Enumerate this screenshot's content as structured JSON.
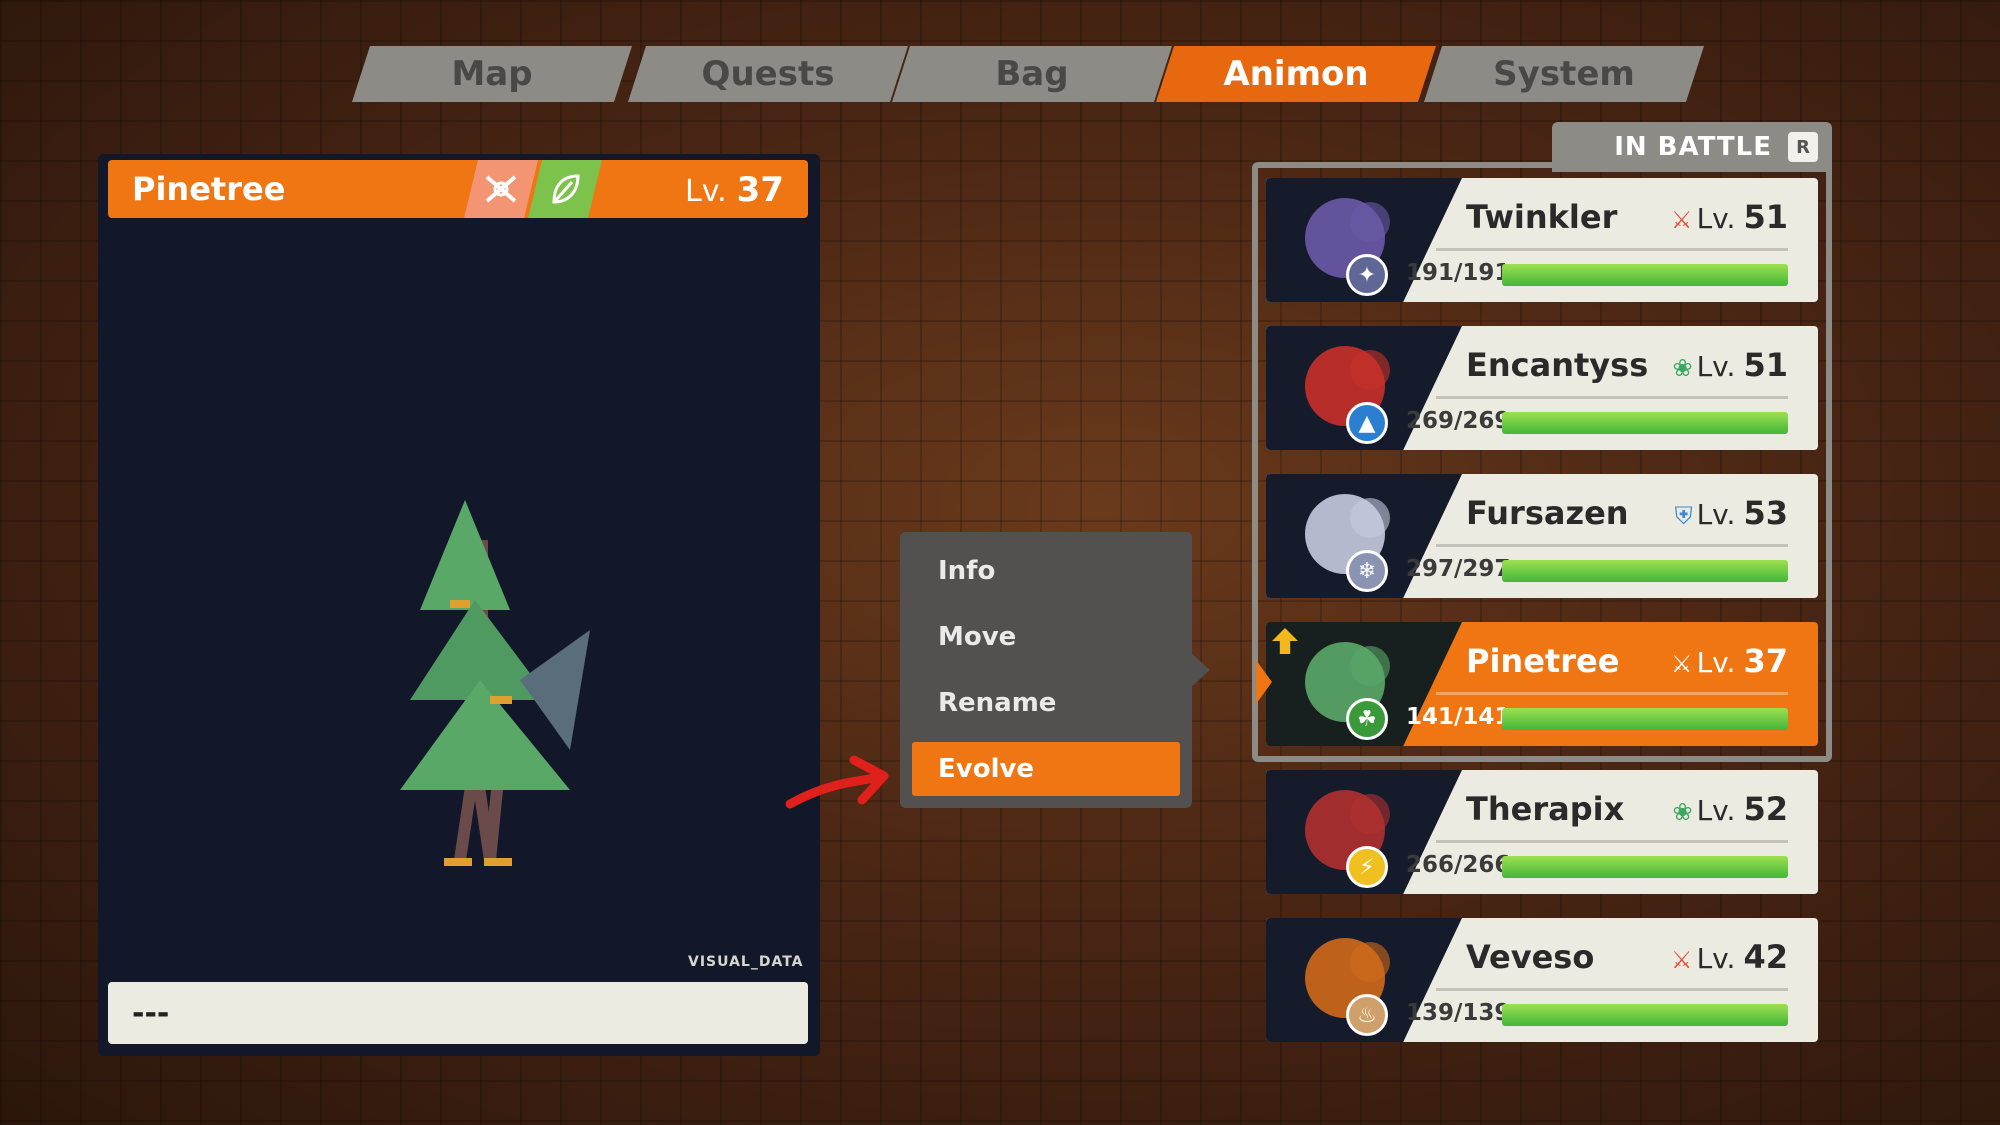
{
  "tabs": [
    {
      "label": "Map",
      "active": false
    },
    {
      "label": "Quests",
      "active": false
    },
    {
      "label": "Bag",
      "active": false
    },
    {
      "label": "Animon",
      "active": true
    },
    {
      "label": "System",
      "active": false
    }
  ],
  "selected_animon": {
    "name": "Pinetree",
    "level_prefix": "Lv.",
    "level": "37",
    "types": [
      "combat-type-icon",
      "grass-leaf-icon"
    ],
    "visual_tag": "VISUAL_DATA",
    "info_text": "---"
  },
  "context_menu": {
    "items": [
      "Info",
      "Move",
      "Rename",
      "Evolve"
    ],
    "selected_index": 3
  },
  "party": {
    "header": "IN BATTLE",
    "header_key": "R",
    "members": [
      {
        "name": "Twinkler",
        "level": "51",
        "hp": "191/191",
        "hp_fraction": 1.0,
        "type_icon": "combat-type-icon",
        "element_icon": "fairy-element-icon",
        "element_color": "#5f6796"
      },
      {
        "name": "Encantyss",
        "level": "51",
        "hp": "269/269",
        "hp_fraction": 1.0,
        "type_icon": "support-type-icon",
        "element_icon": "water-element-icon",
        "element_color": "#2b7fd0"
      },
      {
        "name": "Fursazen",
        "level": "53",
        "hp": "297/297",
        "hp_fraction": 1.0,
        "type_icon": "defense-type-icon",
        "element_icon": "ice-element-icon",
        "element_color": "#8b93b3"
      },
      {
        "name": "Pinetree",
        "level": "37",
        "hp": "141/141",
        "hp_fraction": 1.0,
        "type_icon": "combat-type-icon",
        "element_icon": "grass-element-icon",
        "element_color": "#3a9a3a",
        "selected": true
      },
      {
        "name": "Therapix",
        "level": "52",
        "hp": "266/266",
        "hp_fraction": 1.0,
        "type_icon": "support-type-icon",
        "element_icon": "electric-element-icon",
        "element_color": "#f0c020"
      },
      {
        "name": "Veveso",
        "level": "42",
        "hp": "139/139",
        "hp_fraction": 1.0,
        "type_icon": "combat-type-icon",
        "element_icon": "fire-element-icon",
        "element_color": "#d0a06a"
      }
    ],
    "level_prefix": "Lv."
  },
  "colors": {
    "accent": "#f07613",
    "tab_inactive": "#8d8b86",
    "panel": "#121829",
    "card": "#ecebe2",
    "hp_green": "#45b63a"
  }
}
